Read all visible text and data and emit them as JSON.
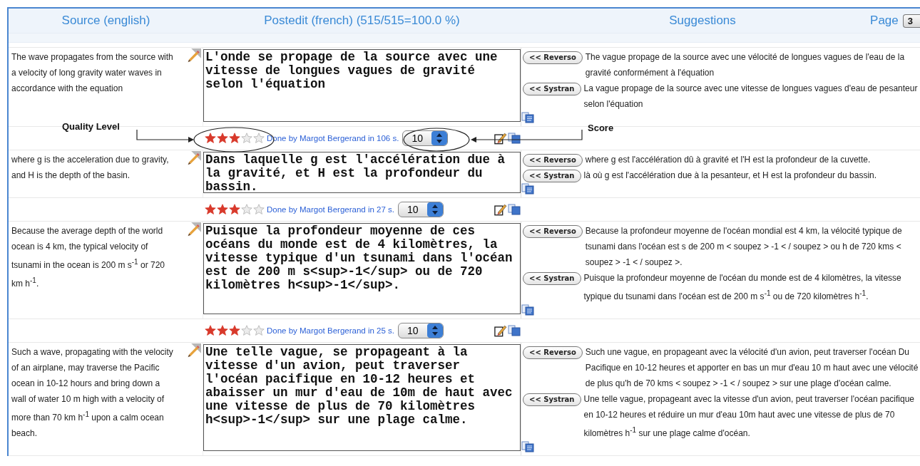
{
  "header": {
    "source_title": "Source (english)",
    "postedit_title": "Postedit (french) (515/515=100.0 %)",
    "suggestions_title": "Suggestions",
    "page_label": "Page",
    "page_value": "3"
  },
  "annotations": [
    {
      "label": "Quality Level"
    },
    {
      "label": "Score"
    }
  ],
  "segments": [
    {
      "source": "The wave propagates from the source with a velocity of long gravity water waves in accordance with the equation",
      "translation": "L'onde se propage de la source avec une vitesse de longues vagues de gravité selon l'équation",
      "suggestions": [
        {
          "engine": "<< Reverso",
          "text": "The vague propage de la source avec une vélocité de longues vagues de l'eau de la gravité conformément à l'équation"
        },
        {
          "engine": "<< Systran",
          "text": "La vague propage de la source avec une vitesse de longues vagues d'eau de pesanteur selon l'équation"
        }
      ],
      "rating": {
        "stars": 3,
        "done_by": "Done by Margot Bergerand in 106 s.",
        "score": "10"
      }
    },
    {
      "source": "where g is the acceleration due to gravity, and H is the depth of the basin.",
      "translation": "Dans laquelle g est l'accélération due à la gravité, et H est la profondeur du bassin.",
      "suggestions": [
        {
          "engine": "<< Reverso",
          "text": "where g est l'accélération dû à gravité et l'H est la profondeur de la cuvette."
        },
        {
          "engine": "<< Systran",
          "text": "là où g est l'accélération due à la pesanteur, et H est la profondeur du bassin."
        }
      ],
      "rating": {
        "stars": 3,
        "done_by": "Done by Margot Bergerand in 27 s.",
        "score": "10"
      }
    },
    {
      "source": "Because the average depth of the world ocean is 4 km, the typical velocity of tsunami in the ocean is 200 m s$^{-1}$ or 720 km h$^{-1}$.",
      "translation": "Puisque la profondeur moyenne de ces océans du monde est de 4 kilomètres, la vitesse typique d'un tsunami dans l'océan est de 200 m s<sup>-1</sup> ou de 720 kilomètres h<sup>-1</sup>.",
      "suggestions": [
        {
          "engine": "<< Reverso",
          "text": "Because la profondeur moyenne de l'océan mondial est 4 km, la vélocité typique de tsunami dans l'océan est s de 200 m < soupez > -1 < / soupez > ou h de 720 kms < soupez > -1 < / soupez >."
        },
        {
          "engine": "<< Systran",
          "text": "Puisque la profondeur moyenne de l'océan du monde est de 4 kilomètres, la vitesse typique du tsunami dans l'océan est de 200 m s$^{-1}$ ou de 720 kilomètres h$^{-1}$."
        }
      ],
      "rating": {
        "stars": 3,
        "done_by": "Done by Margot Bergerand in 25 s.",
        "score": "10"
      }
    },
    {
      "source": "Such a wave, propagating with the velocity of an airplane, may traverse the Pacific ocean in 10-12 hours and bring down a wall of water 10 m high with a velocity of more than 70 km h$^{-1}$ upon a calm ocean beach.",
      "translation": "Une telle vague, se propageant à la vitesse d'un avion, peut traverser l'océan pacifique en 10-12 heures et abaisser un mur d'eau de 10m de haut avec une vitesse de plus de 70 kilomètres h<sup>-1</sup> sur une plage calme.",
      "suggestions": [
        {
          "engine": "<< Reverso",
          "text": "Such une vague, en propageant avec la vélocité d'un avion, peut traverser l'océan Du Pacifique en 10-12 heures et apporter en bas un mur d'eau 10 m haut avec une vélocité de plus qu'h de 70 kms < soupez > -1 < / soupez > sur une plage d'océan calme."
        },
        {
          "engine": "<< Systran",
          "text": "Une telle vague, propageant avec la vitesse d'un avion, peut traverser l'océan pacifique en 10-12 heures et réduire un mur d'eau 10m haut avec une vitesse de plus de 70 kilomètres h$^{-1}$ sur une plage calme d'océan."
        }
      ]
    }
  ]
}
